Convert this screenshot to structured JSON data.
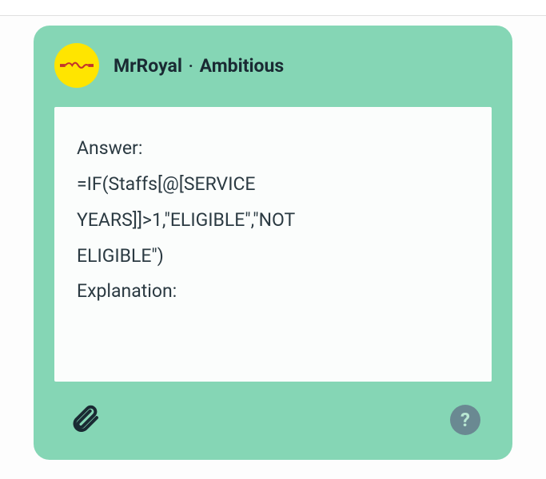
{
  "header": {
    "username": "MrRoyal",
    "rank": "Ambitious"
  },
  "answer": {
    "label_answer": "Answer:",
    "formula": "=IF(Staffs[@[SERVICE YEARS]]>1,\"ELIGIBLE\",\"NOT ELIGIBLE\")",
    "label_explanation": "Explanation:"
  },
  "icons": {
    "attachment": "attachment",
    "help": "?"
  }
}
